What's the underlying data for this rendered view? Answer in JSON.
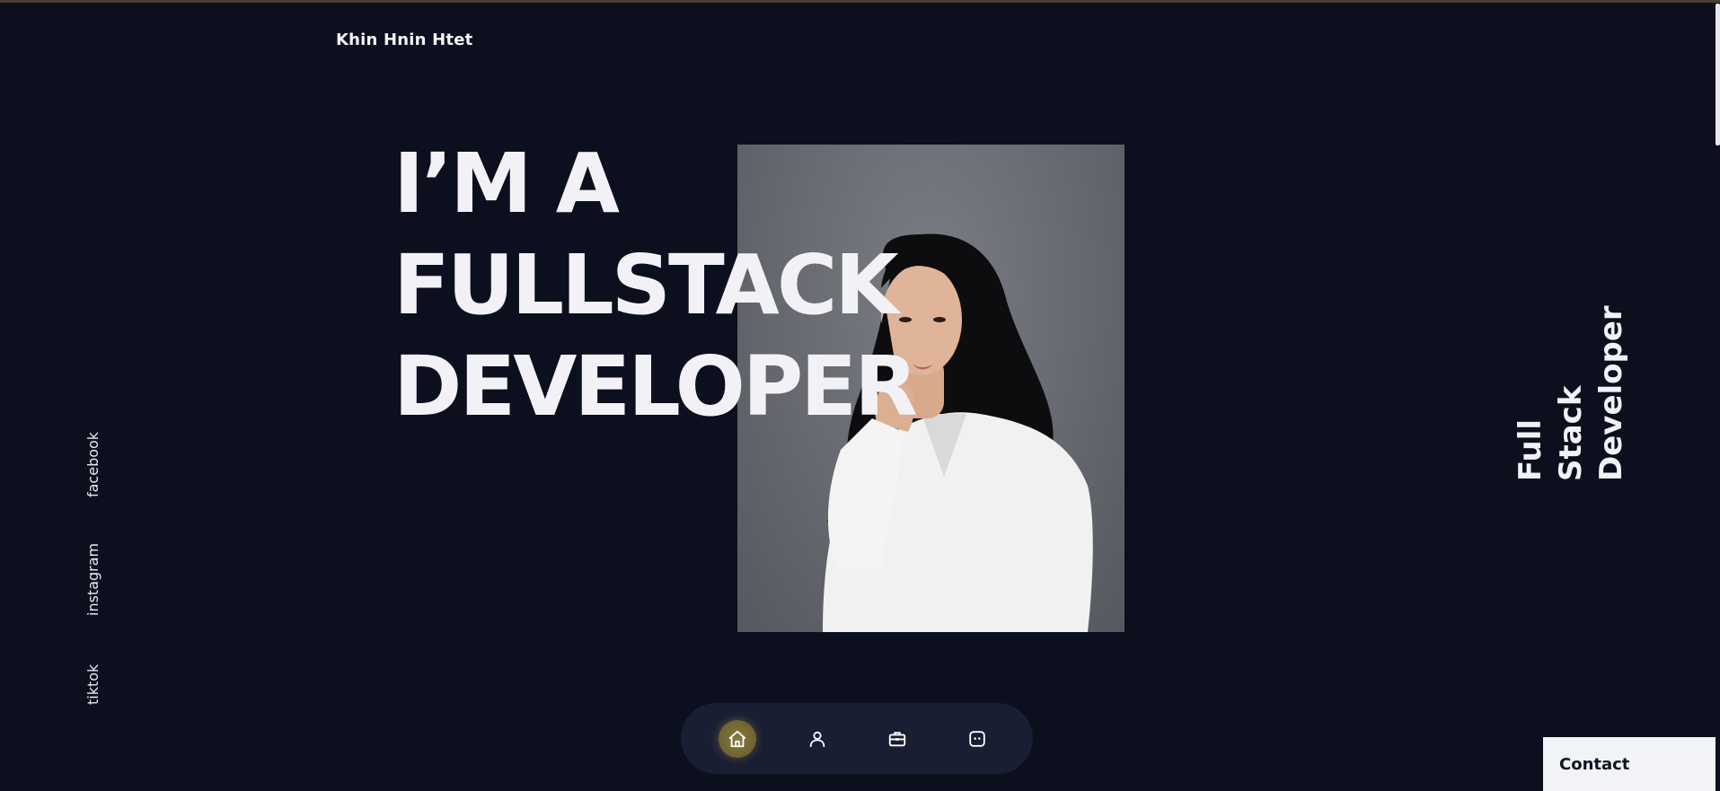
{
  "header": {
    "brand": "Khin Hnin Htet"
  },
  "hero": {
    "title_lines": [
      "I’M A",
      "FULLSTACK",
      "DEVELOPER"
    ],
    "photo_description_icon": "portrait-photo"
  },
  "social_links": [
    "facebook",
    "instagram",
    "tiktok"
  ],
  "side_role": [
    "Full",
    "Stack",
    "Developer"
  ],
  "dock": {
    "items": [
      {
        "icon": "home-icon",
        "active": true
      },
      {
        "icon": "user-icon",
        "active": false
      },
      {
        "icon": "briefcase-icon",
        "active": false
      },
      {
        "icon": "chat-icon",
        "active": false
      }
    ]
  },
  "contact": {
    "label": "Contact"
  },
  "colors": {
    "background": "#0c0f1e",
    "dock": "#1a1e33",
    "accent": "#8a7a3e",
    "text": "#f2f2f6"
  }
}
